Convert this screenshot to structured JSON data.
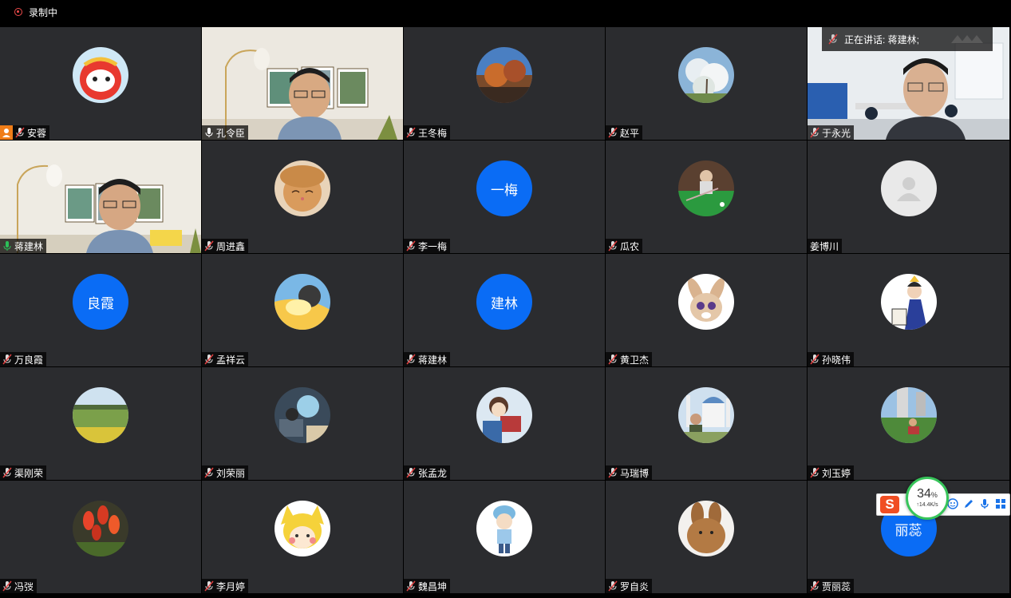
{
  "recording": {
    "label": "录制中"
  },
  "speaking": {
    "label": "正在讲话: 蒋建林;"
  },
  "participants": [
    {
      "name": "安蓉",
      "type": "avatar",
      "host": true,
      "mic": "muted"
    },
    {
      "name": "孔令臣",
      "type": "video",
      "mic": "on"
    },
    {
      "name": "王冬梅",
      "type": "avatar",
      "mic": "muted"
    },
    {
      "name": "赵平",
      "type": "avatar",
      "mic": "muted"
    },
    {
      "name": "于永光",
      "type": "video",
      "mic": "muted"
    },
    {
      "name": "蒋建林",
      "type": "video",
      "mic": "speaking"
    },
    {
      "name": "周进鑫",
      "type": "avatar",
      "mic": "muted"
    },
    {
      "name": "李一梅",
      "type": "text",
      "initials": "一梅",
      "mic": "muted"
    },
    {
      "name": "瓜农",
      "type": "avatar",
      "mic": "muted"
    },
    {
      "name": "姜博川",
      "type": "default",
      "mic": "none"
    },
    {
      "name": "万良霞",
      "type": "text",
      "initials": "良霞",
      "mic": "muted"
    },
    {
      "name": "孟祥云",
      "type": "avatar",
      "mic": "muted"
    },
    {
      "name": "蒋建林",
      "type": "text",
      "initials": "建林",
      "mic": "muted"
    },
    {
      "name": "黄卫杰",
      "type": "avatar",
      "mic": "muted"
    },
    {
      "name": "孙晓伟",
      "type": "avatar",
      "mic": "muted"
    },
    {
      "name": "渠刚荣",
      "type": "avatar",
      "mic": "muted"
    },
    {
      "name": "刘荣丽",
      "type": "avatar",
      "mic": "muted"
    },
    {
      "name": "张孟龙",
      "type": "avatar",
      "mic": "muted"
    },
    {
      "name": "马瑞博",
      "type": "avatar",
      "mic": "muted"
    },
    {
      "name": "刘玉婷",
      "type": "avatar",
      "mic": "muted"
    },
    {
      "name": "冯弢",
      "type": "avatar",
      "mic": "muted"
    },
    {
      "name": "李月婷",
      "type": "avatar",
      "mic": "muted"
    },
    {
      "name": "魏昌坤",
      "type": "avatar",
      "mic": "muted"
    },
    {
      "name": "罗自炎",
      "type": "avatar",
      "mic": "muted"
    },
    {
      "name": "贾丽蕊",
      "type": "text",
      "initials": "丽蕊",
      "mic": "muted"
    }
  ],
  "ime": {
    "logo": "S",
    "cpu_percent": "34",
    "percent_sign": "%",
    "net_speed": "↑14.4K/s"
  }
}
